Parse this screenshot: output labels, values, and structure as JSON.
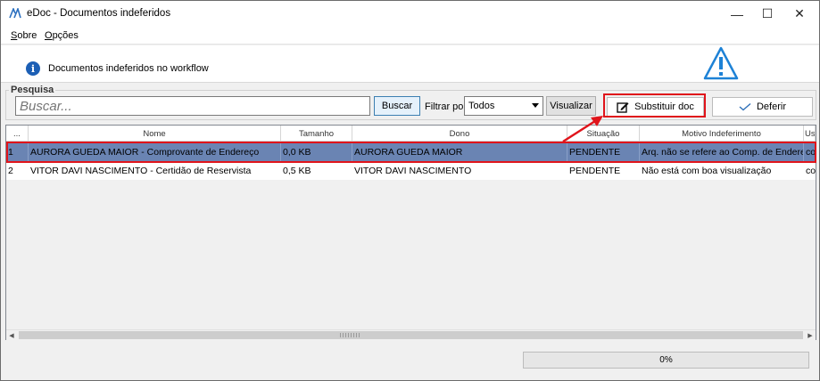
{
  "window": {
    "title": "eDoc - Documentos indeferidos",
    "minimize_glyph": "—",
    "maximize_glyph": "☐",
    "close_glyph": "✕"
  },
  "menu": {
    "items": [
      {
        "accel": "S",
        "rest": "obre"
      },
      {
        "accel": "O",
        "rest": "pções"
      }
    ]
  },
  "banner": {
    "info_icon": "i",
    "text": "Documentos indeferidos no workflow",
    "warning_icon_name": "warning-icon"
  },
  "search": {
    "group_label": "Pesquisa",
    "placeholder": "Buscar...",
    "buscar_label": "Buscar",
    "filter_label": "Filtrar por:",
    "filter_value": "Todos",
    "visualizar_label": "Visualizar",
    "substituir_label": "Substituir doc",
    "deferir_label": "Deferir"
  },
  "grid": {
    "columns": [
      "...",
      "Nome",
      "Tamanho",
      "Dono",
      "Situação",
      "Motivo Indeferimento",
      "Us"
    ],
    "rows": [
      {
        "idx": "1",
        "nome": "AURORA GUEDA MAIOR - Comprovante de Endereço",
        "tamanho": "0,0 KB",
        "dono": "AURORA GUEDA MAIOR",
        "situacao": "PENDENTE",
        "motivo": "Arq. não se refere ao Comp. de Endereço",
        "us": "co"
      },
      {
        "idx": "2",
        "nome": "VITOR DAVI NASCIMENTO - Certidão de Reservista",
        "tamanho": "0,5 KB",
        "dono": "VITOR DAVI NASCIMENTO",
        "situacao": "PENDENTE",
        "motivo": "Não está com boa visualização",
        "us": "co"
      }
    ],
    "selected_row": 1
  },
  "status": {
    "progress_text": "0%",
    "progress_value": 0
  },
  "colors": {
    "selection": "#6a84b3",
    "highlight_red": "#e0141b",
    "info_blue": "#1c5fb5"
  }
}
